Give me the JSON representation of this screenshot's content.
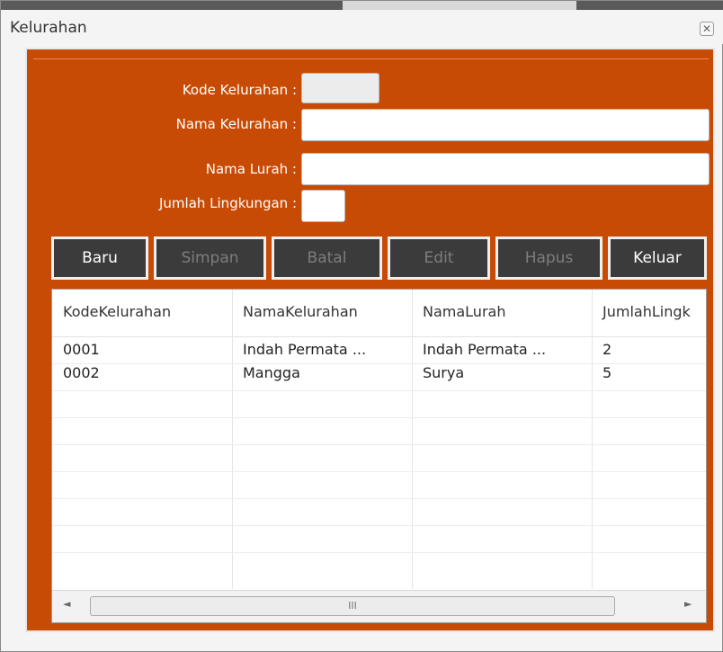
{
  "window": {
    "title": "Kelurahan"
  },
  "form": {
    "kode_label": "Kode Kelurahan :",
    "nama_label": "Nama Kelurahan :",
    "lurah_label": "Nama Lurah :",
    "jumlah_label": "Jumlah Lingkungan :",
    "kode_value": "",
    "nama_value": "",
    "lurah_value": "",
    "jumlah_value": ""
  },
  "buttons": {
    "baru": "Baru",
    "simpan": "Simpan",
    "batal": "Batal",
    "edit": "Edit",
    "hapus": "Hapus",
    "keluar": "Keluar"
  },
  "table": {
    "headers": [
      "KodeKelurahan",
      "NamaKelurahan",
      "NamaLurah",
      "JumlahLingk"
    ],
    "rows": [
      [
        "0001",
        "Indah Permata ...",
        "Indah Permata ...",
        "2"
      ],
      [
        "0002",
        "Mangga",
        "Surya",
        "5"
      ]
    ]
  },
  "scrollbar": {
    "left_arrow": "◄",
    "right_arrow": "►",
    "grip": "III"
  },
  "colors": {
    "panel": "#c84b05",
    "button": "#3b3b3b"
  }
}
